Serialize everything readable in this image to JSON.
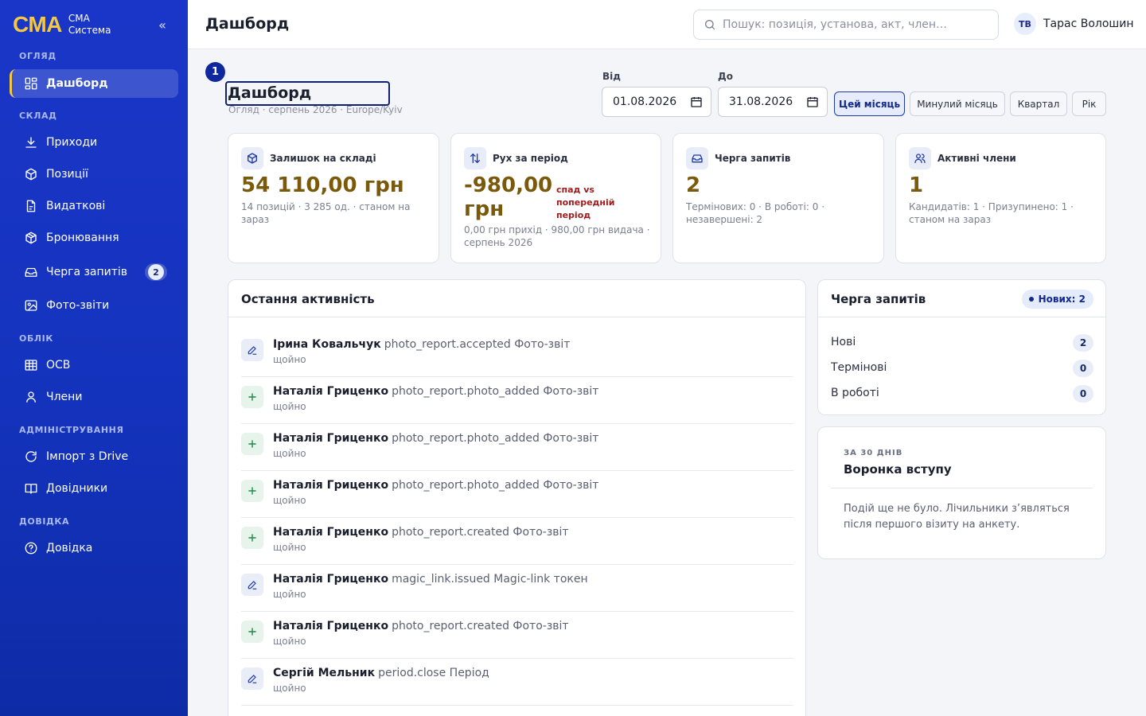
{
  "brand": {
    "logo": "СМА",
    "line1": "СМА",
    "line2": "Система",
    "collapse": "«"
  },
  "sidebar": {
    "sections": [
      "Огляд",
      "Склад",
      "Облік",
      "Адміністрування",
      "Довідка"
    ],
    "items": [
      {
        "label": "Дашборд",
        "icon": "dashboard-grid-icon",
        "active": true
      },
      {
        "label": "Приходи",
        "icon": "download-icon"
      },
      {
        "label": "Позиції",
        "icon": "box-icon"
      },
      {
        "label": "Видаткові",
        "icon": "document-icon"
      },
      {
        "label": "Бронювання",
        "icon": "package-icon"
      },
      {
        "label": "Черга запитів",
        "icon": "inbox-icon",
        "badge": "2"
      },
      {
        "label": "Фото-звіти",
        "icon": "image-icon"
      },
      {
        "label": "ОСВ",
        "icon": "table-icon"
      },
      {
        "label": "Члени",
        "icon": "user-icon"
      },
      {
        "label": "Імпорт з Drive",
        "icon": "refresh-icon"
      },
      {
        "label": "Довідники",
        "icon": "book-icon"
      },
      {
        "label": "Довідка",
        "icon": "help-icon"
      }
    ]
  },
  "topbar": {
    "title": "Дашборд",
    "search_placeholder": "Пошук: позиція, установа, акт, член…",
    "user_initials": "ТВ",
    "user_name": "Тарас Волошин"
  },
  "page": {
    "step": "1",
    "title": "Дашборд",
    "subtitle": "Огляд · серпень 2026 · Europe/Kyiv"
  },
  "filters": {
    "from_label": "Від",
    "from_value": "01.08.2026",
    "to_label": "До",
    "to_value": "31.08.2026",
    "presets": [
      "Цей місяць",
      "Минулий місяць",
      "Квартал",
      "Рік"
    ],
    "active_preset": "Цей місяць"
  },
  "kpis": [
    {
      "title": "Залишок на складі",
      "icon": "box-icon",
      "value": "54 110,00 грн",
      "note": "14 позицій · 3 285 од. · станом на зараз"
    },
    {
      "title": "Рух за період",
      "icon": "arrows-updown-icon",
      "value_line1": "-980,00",
      "value_line2": "грн",
      "alert": "спад vs попередній період",
      "note": "0,00 грн прихід · 980,00 грн видача · серпень 2026"
    },
    {
      "title": "Черга запитів",
      "icon": "inbox-icon",
      "value": "2",
      "note": "Термінових: 0 · В роботі: 0 · незавершені: 2"
    },
    {
      "title": "Активні члени",
      "icon": "users-icon",
      "value": "1",
      "note": "Кандидатів: 1 · Призупинено: 1 · станом на зараз"
    }
  ],
  "activity": {
    "title": "Остання активність",
    "items": [
      {
        "icon": "edit",
        "name": "Ірина Ковальчук",
        "event": "photo_report.accepted Фото-звіт",
        "time": "щойно"
      },
      {
        "icon": "plus",
        "name": "Наталія Гриценко",
        "event": "photo_report.photo_added Фото-звіт",
        "time": "щойно"
      },
      {
        "icon": "plus",
        "name": "Наталія Гриценко",
        "event": "photo_report.photo_added Фото-звіт",
        "time": "щойно"
      },
      {
        "icon": "plus",
        "name": "Наталія Гриценко",
        "event": "photo_report.photo_added Фото-звіт",
        "time": "щойно"
      },
      {
        "icon": "plus",
        "name": "Наталія Гриценко",
        "event": "photo_report.created Фото-звіт",
        "time": "щойно"
      },
      {
        "icon": "edit",
        "name": "Наталія Гриценко",
        "event": "magic_link.issued Magic-link токен",
        "time": "щойно"
      },
      {
        "icon": "plus",
        "name": "Наталія Гриценко",
        "event": "photo_report.created Фото-звіт",
        "time": "щойно"
      },
      {
        "icon": "edit",
        "name": "Сергій Мельник",
        "event": "period.close Період",
        "time": "щойно"
      }
    ]
  },
  "queue": {
    "title": "Черга запитів",
    "badge": "Нових: 2",
    "rows": [
      {
        "label": "Нові",
        "count": "2"
      },
      {
        "label": "Термінові",
        "count": "0"
      },
      {
        "label": "В роботі",
        "count": "0"
      }
    ]
  },
  "funnel": {
    "caption": "за 30 днів",
    "title": "Воронка вступу",
    "text": "Подій ще не було. Лічильники з’являться після першого візиту на анкету."
  },
  "colors": {
    "sidebar": "#1433bd",
    "accent_gold": "#f5c842",
    "value_brown": "#7a5a0a",
    "alert_red": "#9b1c1c",
    "primary": "#12298c"
  }
}
